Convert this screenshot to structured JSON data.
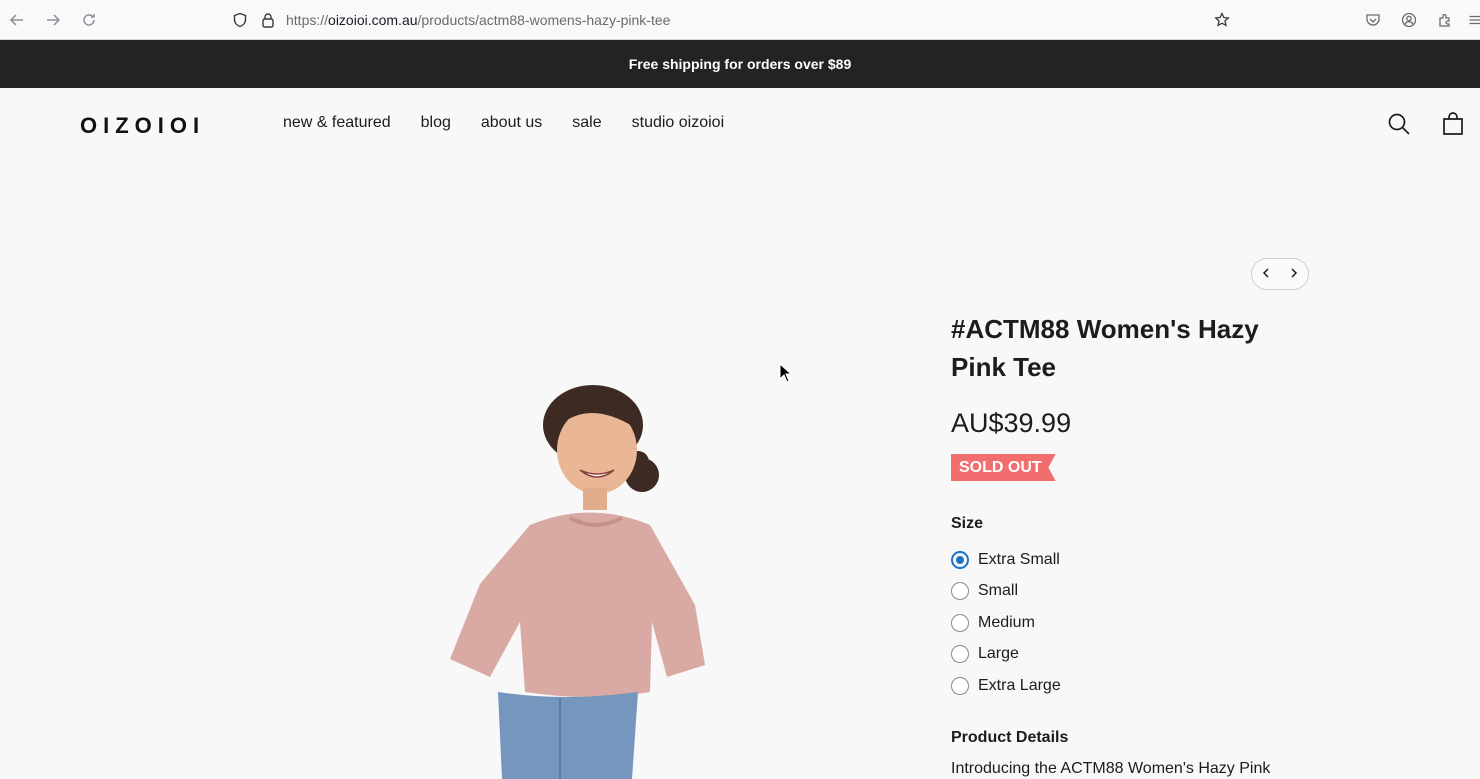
{
  "browser": {
    "url_prefix": "https://",
    "url_host": "oizoioi.com.au",
    "url_path": "/products/actm88-womens-hazy-pink-tee"
  },
  "announcement": "Free shipping for orders over $89",
  "header": {
    "logo_text": "OIZOIOI",
    "nav": [
      "new & featured",
      "blog",
      "about us",
      "sale",
      "studio oizoioi"
    ]
  },
  "product": {
    "title": "#ACTM88 Women's Hazy Pink Tee",
    "price": "AU$39.99",
    "badge": "SOLD OUT",
    "size_label": "Size",
    "sizes": [
      "Extra Small",
      "Small",
      "Medium",
      "Large",
      "Extra Large"
    ],
    "selected_size": "Extra Small",
    "details_heading": "Product Details",
    "details_text": "Introducing the ACTM88 Women's Hazy Pink"
  },
  "colors": {
    "announcement_bg": "#232323",
    "badge_bg": "#f26d6d",
    "radio_accent": "#1a73c7",
    "tee_color": "#d9aaa3"
  },
  "icons": [
    "back-icon",
    "forward-icon",
    "reload-icon",
    "shield-icon",
    "lock-icon",
    "bookmark-star-icon",
    "pocket-icon",
    "account-icon",
    "extensions-icon",
    "menu-icon",
    "search-icon",
    "cart-icon",
    "chevron-left-icon",
    "chevron-right-icon"
  ]
}
